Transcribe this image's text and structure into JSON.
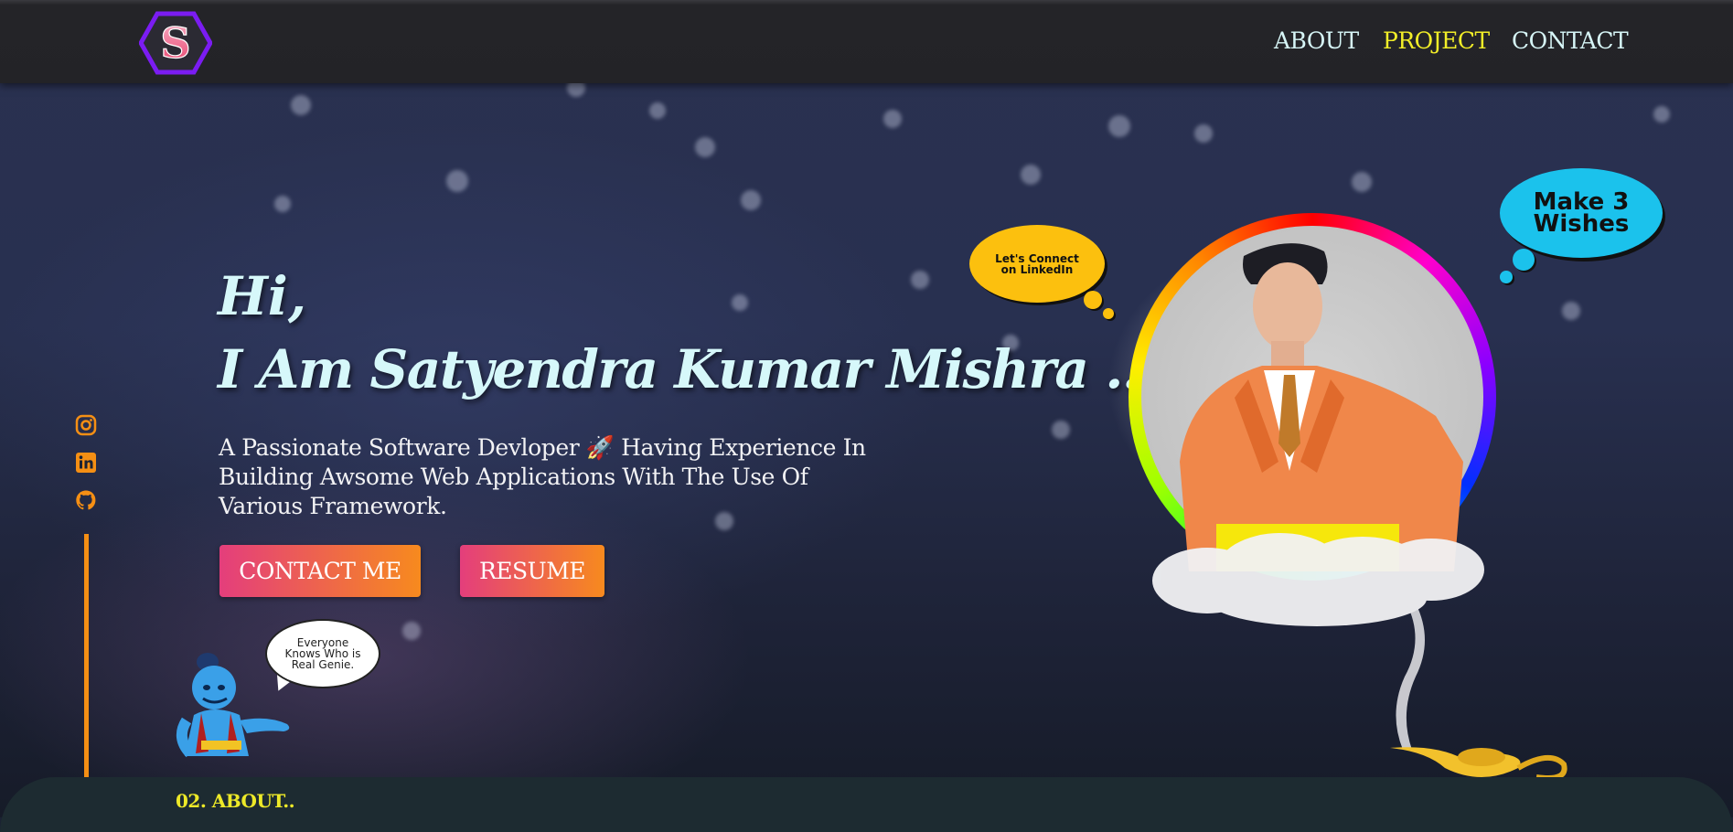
{
  "navbar": {
    "logo_letter": "S",
    "links": [
      {
        "label": "ABOUT",
        "active": false
      },
      {
        "label": "PROJECT",
        "active": true
      },
      {
        "label": "CONTACT",
        "active": false
      }
    ]
  },
  "socials": [
    "instagram-icon",
    "linkedin-icon",
    "github-icon"
  ],
  "hero": {
    "greeting": "Hi,",
    "name": "I Am Satyendra Kumar Mishra ..",
    "intro_line1": "A Passionate Software Devloper 🚀 Having Experience In",
    "intro_line2": "Building Awsome Web Applications With The Use Of",
    "intro_line3": "Various Framework.",
    "contact_button": "CONTACT ME",
    "resume_button": "RESUME"
  },
  "genie": {
    "speech_line1": "Everyone",
    "speech_line2": "Knows Who is",
    "speech_line3": "Real Genie."
  },
  "thoughts": {
    "linkedin_line1": "Let's Connect",
    "linkedin_line2": "on LinkedIn",
    "wishes_line1": "Make 3",
    "wishes_line2": "Wishes"
  },
  "about": {
    "title": "02. ABOUT.."
  },
  "colors": {
    "accent_yellow": "#f2ee28",
    "nav_text": "#d7f6f7",
    "button_start": "#e43e7c",
    "button_end": "#f78a1e",
    "side_line": "#f58f14",
    "logo_ring": "#7b1cf2"
  }
}
